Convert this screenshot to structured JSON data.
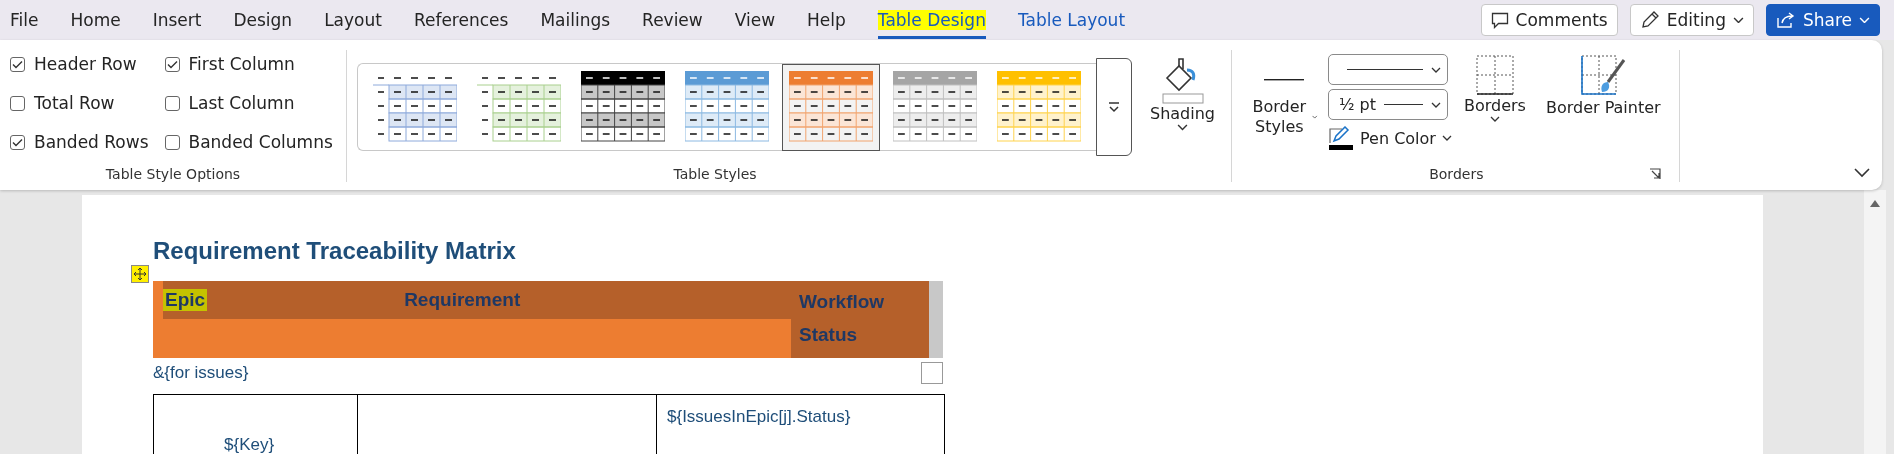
{
  "tabs": [
    {
      "label": "File",
      "selected": false,
      "highlighted": false,
      "kind": "main"
    },
    {
      "label": "Home",
      "selected": false,
      "highlighted": false,
      "kind": "main"
    },
    {
      "label": "Insert",
      "selected": false,
      "highlighted": false,
      "kind": "main"
    },
    {
      "label": "Design",
      "selected": false,
      "highlighted": false,
      "kind": "main"
    },
    {
      "label": "Layout",
      "selected": false,
      "highlighted": false,
      "kind": "main"
    },
    {
      "label": "References",
      "selected": false,
      "highlighted": false,
      "kind": "main"
    },
    {
      "label": "Mailings",
      "selected": false,
      "highlighted": false,
      "kind": "main"
    },
    {
      "label": "Review",
      "selected": false,
      "highlighted": false,
      "kind": "main"
    },
    {
      "label": "View",
      "selected": false,
      "highlighted": false,
      "kind": "main"
    },
    {
      "label": "Help",
      "selected": false,
      "highlighted": false,
      "kind": "main"
    },
    {
      "label": "Table Design",
      "selected": true,
      "highlighted": true,
      "kind": "context"
    },
    {
      "label": "Table Layout",
      "selected": false,
      "highlighted": false,
      "kind": "context"
    }
  ],
  "top_buttons": [
    {
      "kind": "comments",
      "label": "Comments"
    },
    {
      "kind": "editing",
      "label": "Editing"
    },
    {
      "kind": "share",
      "label": "Share"
    }
  ],
  "table_style_options": {
    "label": "Table Style Options",
    "items": [
      {
        "label": "Header Row",
        "checked": true
      },
      {
        "label": "First Column",
        "checked": true
      },
      {
        "label": "Total Row",
        "checked": false
      },
      {
        "label": "Last Column",
        "checked": false
      },
      {
        "label": "Banded Rows",
        "checked": true
      },
      {
        "label": "Banded Columns",
        "checked": false
      }
    ]
  },
  "table_styles": {
    "label": "Table Styles",
    "items": [
      {
        "kind": "light",
        "color": "#8eaadb",
        "selected": false
      },
      {
        "kind": "light",
        "color": "#a9d08e",
        "selected": false
      },
      {
        "kind": "filled",
        "color": "#000000",
        "selected": false
      },
      {
        "kind": "filled",
        "color": "#5b9bd5",
        "selected": false
      },
      {
        "kind": "filled",
        "color": "#ed7d31",
        "selected": true
      },
      {
        "kind": "filled",
        "color": "#a5a5a5",
        "selected": false
      },
      {
        "kind": "filled",
        "color": "#ffc000",
        "selected": false
      }
    ]
  },
  "shading": {
    "label": "Shading"
  },
  "borders": {
    "label": "Borders",
    "border_styles": "Border Styles",
    "weight": "½ pt",
    "pen_color": "Pen Color",
    "borders_button": "Borders",
    "border_painter": "Border Painter"
  },
  "document": {
    "title": "Requirement Traceability Matrix",
    "header": [
      {
        "label": "Epic",
        "highlighted": true
      },
      {
        "label": "Requirement",
        "highlighted": false
      },
      {
        "label": "Workflow Status",
        "highlighted": false
      }
    ],
    "loop_text": "&{for issues}",
    "rows": [
      {
        "cells": [
          {
            "text": "${Key}"
          },
          {},
          {
            "text": "${IssuesInEpic[j].Status}"
          }
        ]
      }
    ]
  }
}
